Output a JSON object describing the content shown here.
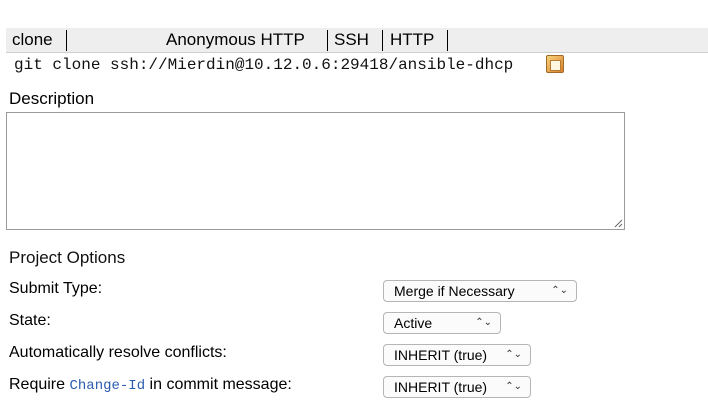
{
  "clone": {
    "label": "clone",
    "protocols": [
      "Anonymous HTTP",
      "SSH",
      "HTTP"
    ],
    "command": "git clone ssh://Mierdin@10.12.0.6:29418/ansible-dhcp",
    "copy_icon": "copy-icon"
  },
  "description": {
    "title": "Description",
    "value": "",
    "resize_icon": "resize-grip-icon"
  },
  "project_options": {
    "title": "Project Options",
    "rows": [
      {
        "label": "Submit Type:",
        "value": "Merge if Necessary"
      },
      {
        "label": "State:",
        "value": "Active"
      },
      {
        "label": "Automatically resolve conflicts:",
        "value": "INHERIT (true)"
      },
      {
        "label_prefix": "Require ",
        "label_code": "Change-Id",
        "label_suffix": " in commit message:",
        "value": "INHERIT (true)"
      }
    ],
    "select_arrows": "⌃⌄"
  },
  "colors": {
    "bar_bg": "#eeeeee",
    "code_link": "#2a5db0"
  }
}
